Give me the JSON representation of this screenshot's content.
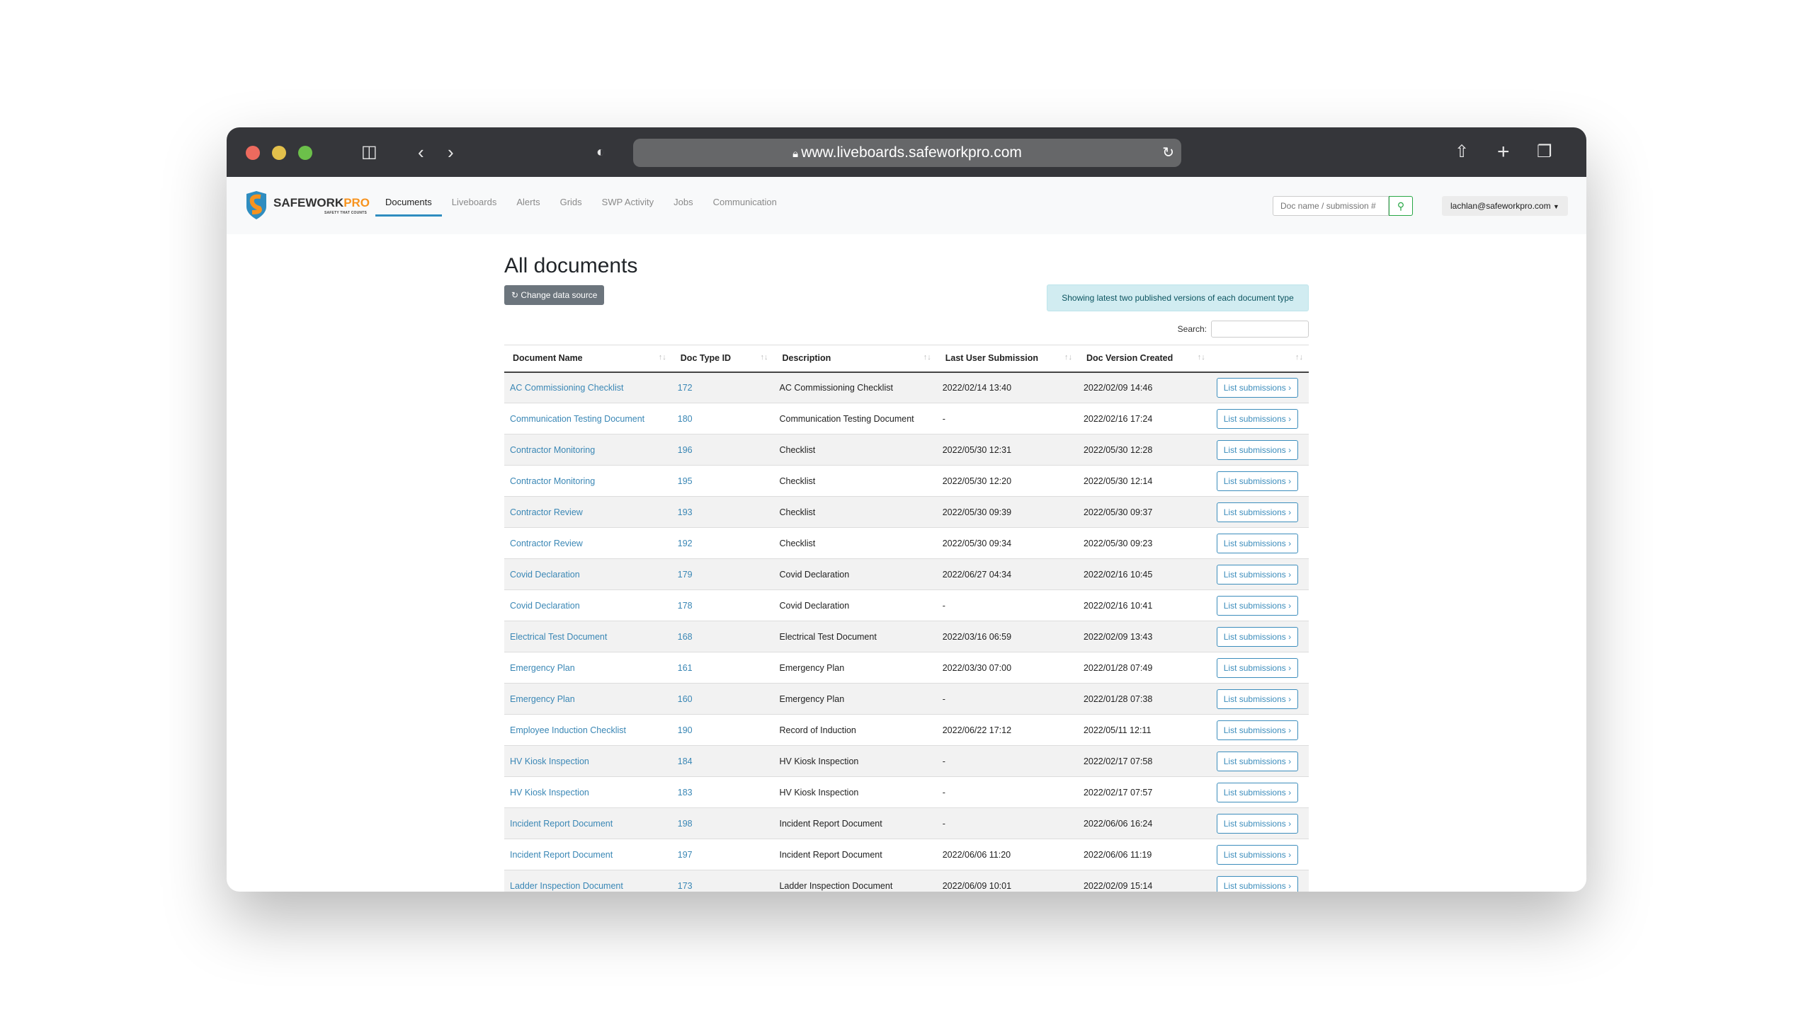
{
  "browser": {
    "url": "www.liveboards.safeworkpro.com"
  },
  "brand": {
    "name_a": "SAFEW",
    "name_b": "O",
    "name_c": "RK",
    "name_d": "PRO",
    "tagline": "SAFETY THAT COUNTS",
    "colors": {
      "orange": "#f7931e",
      "blue": "#2f8dc0"
    }
  },
  "nav": {
    "items": [
      {
        "label": "Documents",
        "active": true
      },
      {
        "label": "Liveboards"
      },
      {
        "label": "Alerts"
      },
      {
        "label": "Grids"
      },
      {
        "label": "SWP Activity"
      },
      {
        "label": "Jobs"
      },
      {
        "label": "Communication"
      }
    ],
    "search_placeholder": "Doc name / submission #",
    "user": "lachlan@safeworkpro.com"
  },
  "page": {
    "title": "All documents",
    "change_source": "Change data source",
    "info": "Showing latest two published versions of each document type",
    "search_label": "Search:"
  },
  "table": {
    "headers": [
      "Document Name",
      "Doc Type ID",
      "Description",
      "Last User Submission",
      "Doc Version Created",
      ""
    ],
    "button_label": "List submissions ›",
    "rows": [
      [
        "AC Commissioning Checklist",
        "172",
        "AC Commissioning Checklist",
        "2022/02/14 13:40",
        "2022/02/09 14:46"
      ],
      [
        "Communication Testing Document",
        "180",
        "Communication Testing Document",
        "-",
        "2022/02/16 17:24"
      ],
      [
        "Contractor Monitoring",
        "196",
        "Checklist",
        "2022/05/30 12:31",
        "2022/05/30 12:28"
      ],
      [
        "Contractor Monitoring",
        "195",
        "Checklist",
        "2022/05/30 12:20",
        "2022/05/30 12:14"
      ],
      [
        "Contractor Review",
        "193",
        "Checklist",
        "2022/05/30 09:39",
        "2022/05/30 09:37"
      ],
      [
        "Contractor Review",
        "192",
        "Checklist",
        "2022/05/30 09:34",
        "2022/05/30 09:23"
      ],
      [
        "Covid Declaration",
        "179",
        "Covid Declaration",
        "2022/06/27 04:34",
        "2022/02/16 10:45"
      ],
      [
        "Covid Declaration",
        "178",
        "Covid Declaration",
        "-",
        "2022/02/16 10:41"
      ],
      [
        "Electrical Test Document",
        "168",
        "Electrical Test Document",
        "2022/03/16 06:59",
        "2022/02/09 13:43"
      ],
      [
        "Emergency Plan",
        "161",
        "Emergency Plan",
        "2022/03/30 07:00",
        "2022/01/28 07:49"
      ],
      [
        "Emergency Plan",
        "160",
        "Emergency Plan",
        "-",
        "2022/01/28 07:38"
      ],
      [
        "Employee Induction Checklist",
        "190",
        "Record of Induction",
        "2022/06/22 17:12",
        "2022/05/11 12:11"
      ],
      [
        "HV Kiosk Inspection",
        "184",
        "HV Kiosk Inspection",
        "-",
        "2022/02/17 07:58"
      ],
      [
        "HV Kiosk Inspection",
        "183",
        "HV Kiosk Inspection",
        "-",
        "2022/02/17 07:57"
      ],
      [
        "Incident Report Document",
        "198",
        "Incident Report Document",
        "-",
        "2022/06/06 16:24"
      ],
      [
        "Incident Report Document",
        "197",
        "Incident Report Document",
        "2022/06/06 11:20",
        "2022/06/06 11:19"
      ],
      [
        "Ladder Inspection Document",
        "173",
        "Ladder Inspection Document",
        "2022/06/09 10:01",
        "2022/02/09 15:14"
      ]
    ]
  }
}
